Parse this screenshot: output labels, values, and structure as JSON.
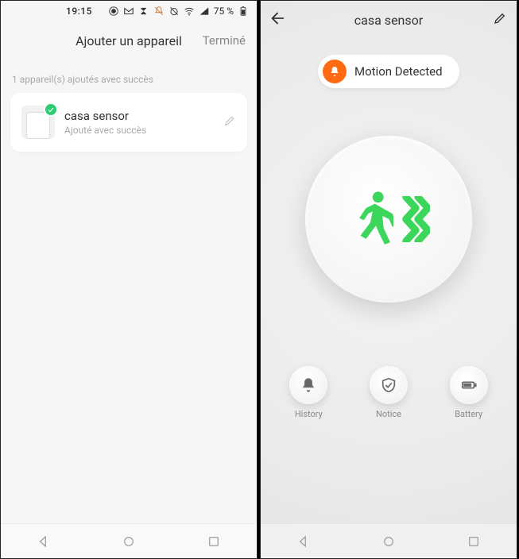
{
  "left": {
    "statusbar": {
      "time": "19:15",
      "battery_pct": "75 %"
    },
    "header": {
      "title": "Ajouter un appareil",
      "done": "Terminé"
    },
    "subtext": "1 appareil(s) ajoutés avec succès",
    "device": {
      "name": "casa sensor",
      "status": "Ajouté avec succès"
    }
  },
  "right": {
    "header": {
      "title": "casa sensor"
    },
    "motion_label": "Motion Detected",
    "bottom": [
      {
        "id": "history",
        "label": "History"
      },
      {
        "id": "notice",
        "label": "Notice"
      },
      {
        "id": "battery",
        "label": "Battery"
      }
    ]
  }
}
